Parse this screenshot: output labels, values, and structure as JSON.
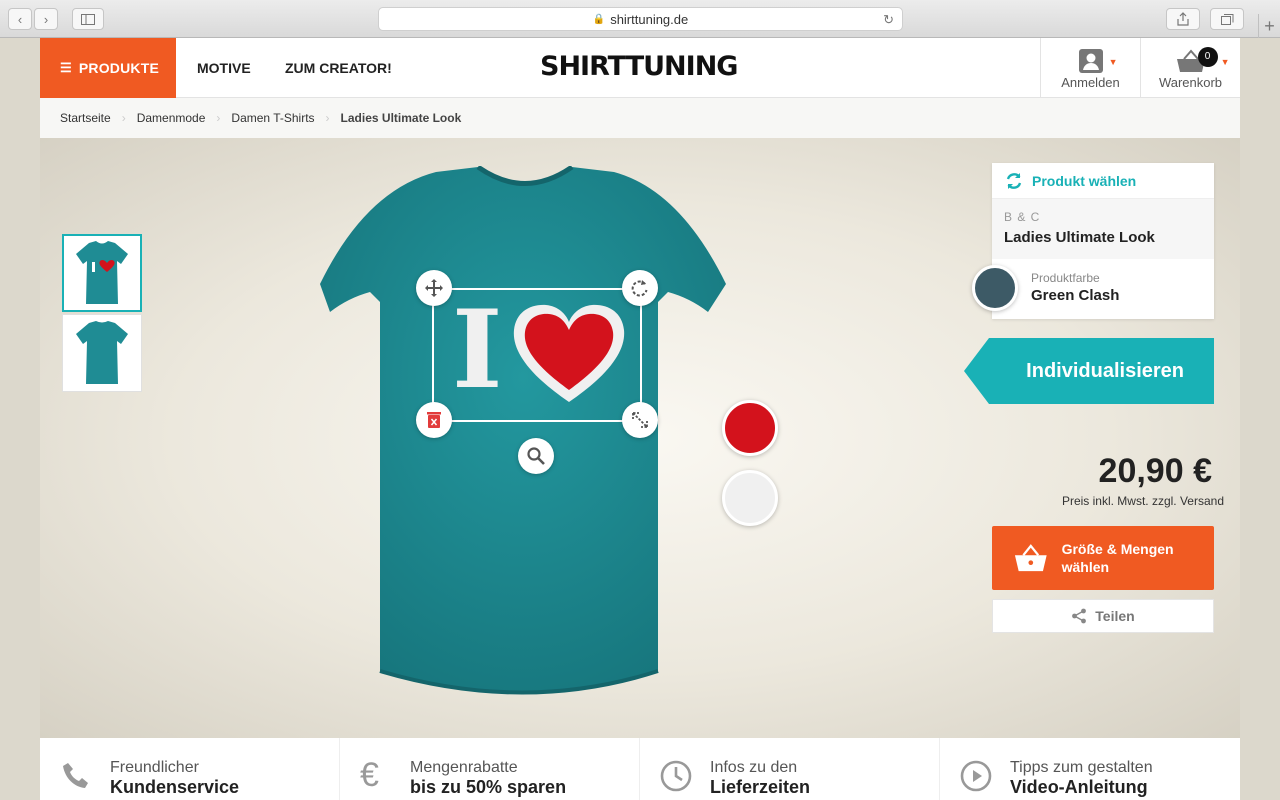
{
  "browser": {
    "url": "shirttuning.de"
  },
  "header": {
    "produkte_label": "PRODUKTE",
    "motive_label": "MOTIVE",
    "creator_label": "ZUM CREATOR!",
    "logo_text": "SHIRTTUNING",
    "login_label": "Anmelden",
    "cart_label": "Warenkorb",
    "cart_count": "0"
  },
  "breadcrumb": [
    "Startseite",
    "Damenmode",
    "Damen T-Shirts",
    "Ladies Ultimate Look"
  ],
  "design": {
    "motif_text": "I"
  },
  "panel": {
    "head": "Produkt wählen",
    "brand": "B & C",
    "product_name": "Ladies Ultimate Look",
    "color_label": "Produktfarbe",
    "color_value": "Green Clash"
  },
  "actions": {
    "customize": "Individualisieren",
    "price": "20,90 €",
    "price_note": "Preis inkl. Mwst. zzgl. Versand",
    "cart_button": "Größe & Mengen wählen",
    "share_button": "Teilen"
  },
  "colors": {
    "accent": "#f05a22",
    "teal": "#19b1b6",
    "shirt": "#1f8c94",
    "product_color": "#3d5a66",
    "print_red": "#d3121c",
    "print_white": "#f0f0f0"
  },
  "features": [
    {
      "line1": "Freundlicher",
      "line2": "Kundenservice",
      "icon": "phone-icon"
    },
    {
      "line1": "Mengenrabatte",
      "line2": "bis zu 50% sparen",
      "icon": "euro-icon"
    },
    {
      "line1": "Infos zu den",
      "line2": "Lieferzeiten",
      "icon": "clock-icon"
    },
    {
      "line1": "Tipps zum gestalten",
      "line2": "Video-Anleitung",
      "icon": "play-icon"
    }
  ]
}
